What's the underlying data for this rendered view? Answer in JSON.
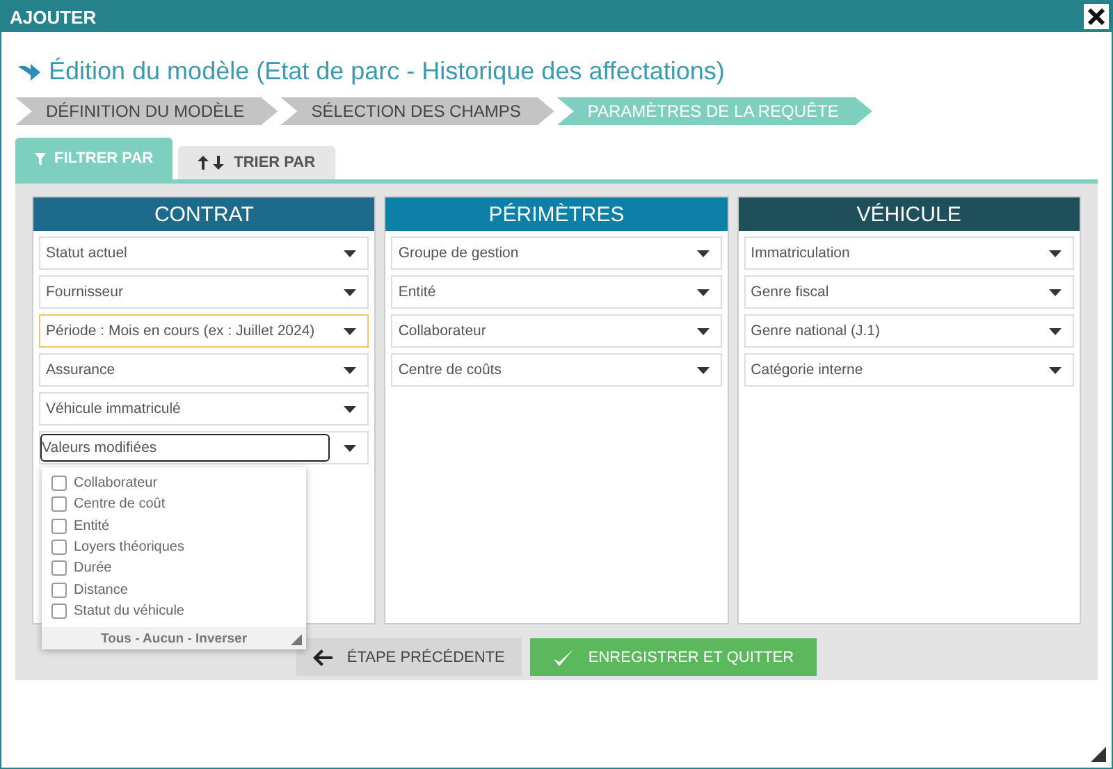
{
  "window": {
    "title": "AJOUTER"
  },
  "heading": "Édition du modèle (Etat de parc - Historique des affectations)",
  "steps": [
    {
      "label": "DÉFINITION DU MODÈLE",
      "selected": false
    },
    {
      "label": "SÉLECTION DES CHAMPS",
      "selected": false
    },
    {
      "label": "PARAMÈTRES DE LA REQUÊTE",
      "selected": true
    }
  ],
  "tabs": [
    {
      "label": "FILTRER PAR",
      "kind": "filter",
      "selected": true
    },
    {
      "label": "TRIER PAR",
      "kind": "sort",
      "selected": false
    }
  ],
  "columns": [
    {
      "title": "CONTRAT",
      "color": "#1d6a8a",
      "fields": [
        {
          "label": "Statut actuel",
          "focused": false,
          "expanded": false
        },
        {
          "label": "Fournisseur",
          "focused": false,
          "expanded": false
        },
        {
          "label": "Période : Mois en cours (ex : Juillet 2024)",
          "focused": true,
          "expanded": false
        },
        {
          "label": "Assurance",
          "focused": false,
          "expanded": false
        },
        {
          "label": "Véhicule immatriculé",
          "focused": false,
          "expanded": false
        },
        {
          "label": "Valeurs modifiées",
          "focused": false,
          "expanded": true,
          "options": [
            {
              "label": "Collaborateur",
              "checked": false
            },
            {
              "label": "Centre de coût",
              "checked": false
            },
            {
              "label": "Entité",
              "checked": false
            },
            {
              "label": "Loyers théoriques",
              "checked": false
            },
            {
              "label": "Durée",
              "checked": false
            },
            {
              "label": "Distance",
              "checked": false
            },
            {
              "label": "Statut du véhicule",
              "checked": false
            }
          ],
          "actions": "Tous - Aucun - Inverser"
        }
      ]
    },
    {
      "title": "PÉRIMÈTRES",
      "color": "#0e7fa6",
      "fields": [
        {
          "label": "Groupe de gestion",
          "focused": false,
          "expanded": false
        },
        {
          "label": "Entité",
          "focused": false,
          "expanded": false
        },
        {
          "label": "Collaborateur",
          "focused": false,
          "expanded": false
        },
        {
          "label": "Centre de coûts",
          "focused": false,
          "expanded": false
        }
      ]
    },
    {
      "title": "VÉHICULE",
      "color": "#1f4f5a",
      "fields": [
        {
          "label": "Immatriculation",
          "focused": false,
          "expanded": false
        },
        {
          "label": "Genre fiscal",
          "focused": false,
          "expanded": false
        },
        {
          "label": "Genre national (J.1)",
          "focused": false,
          "expanded": false
        },
        {
          "label": "Catégorie interne",
          "focused": false,
          "expanded": false
        }
      ]
    }
  ],
  "buttons": [
    {
      "label": "ÉTAPE PRÉCÉDENTE",
      "kind": "back"
    },
    {
      "label": "ENREGISTRER ET QUITTER",
      "kind": "save"
    }
  ]
}
